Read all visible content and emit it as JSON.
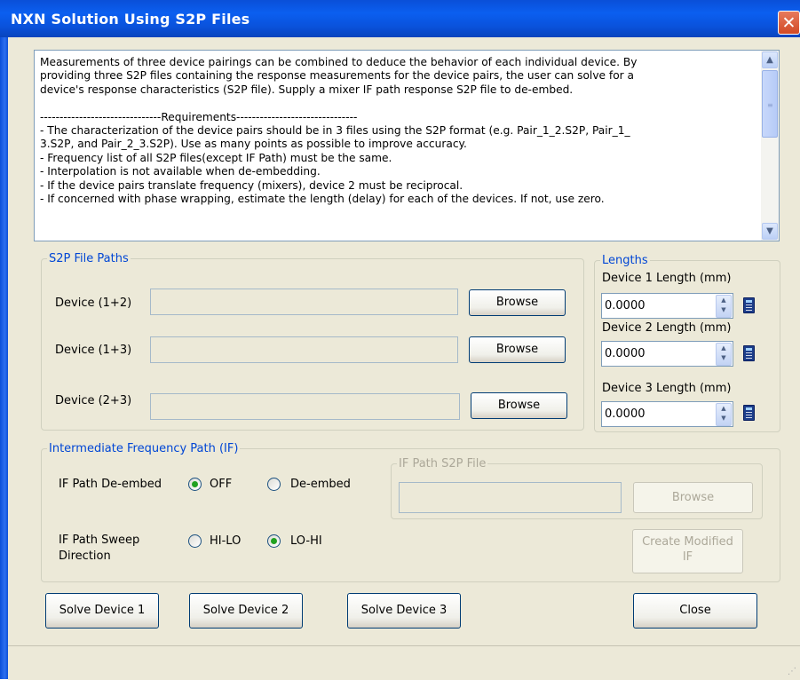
{
  "window": {
    "title": "NXN Solution Using S2P Files",
    "close_glyph": "✕"
  },
  "description_lines": [
    "Measurements of three device pairings can be combined to deduce the behavior of each individual device.  By",
    "providing three S2P files containing the response measurements for the device pairs, the user can solve for a",
    "device's response characteristics (S2P file).  Supply a mixer IF path response S2P file to de-embed.",
    "",
    "-------------------------------Requirements-------------------------------",
    "- The characterization of the device pairs should be in 3 files using the S2P format (e.g. Pair_1_2.S2P, Pair_1_",
    "3.S2P, and Pair_2_3.S2P).  Use as many points as possible to improve accuracy.",
    "- Frequency list of all S2P files(except IF Path) must be the same.",
    "- Interpolation is not available when de-embedding.",
    "- If the device pairs translate frequency (mixers), device 2 must be reciprocal.",
    "- If concerned with phase wrapping, estimate the length (delay) for each of the devices.  If not, use zero."
  ],
  "s2p_paths": {
    "legend": "S2P File Paths",
    "rows": [
      {
        "label": "Device (1+2)",
        "value": "",
        "button": "Browse"
      },
      {
        "label": "Device (1+3)",
        "value": "",
        "button": "Browse"
      },
      {
        "label": "Device (2+3)",
        "value": "",
        "button": "Browse"
      }
    ]
  },
  "lengths": {
    "legend": "Lengths",
    "items": [
      {
        "label": "Device 1 Length (mm)",
        "value": "0.0000"
      },
      {
        "label": "Device 2 Length (mm)",
        "value": "0.0000"
      },
      {
        "label": "Device 3 Length (mm)",
        "value": "0.0000"
      }
    ]
  },
  "if_path": {
    "legend": "Intermediate Frequency Path (IF)",
    "deembed_label": "IF Path De-embed",
    "deembed_options": [
      "OFF",
      "De-embed"
    ],
    "deembed_selected": "OFF",
    "sweep_label_line1": "IF Path Sweep",
    "sweep_label_line2": "Direction",
    "sweep_options": [
      "HI-LO",
      "LO-HI"
    ],
    "sweep_selected": "LO-HI",
    "s2p_file_legend": "IF Path S2P File",
    "s2p_file_value": "",
    "browse": "Browse",
    "create_modified_line1": "Create Modified",
    "create_modified_line2": "IF"
  },
  "actions": {
    "solve1": "Solve Device 1",
    "solve2": "Solve Device 2",
    "solve3": "Solve Device 3",
    "close": "Close"
  }
}
